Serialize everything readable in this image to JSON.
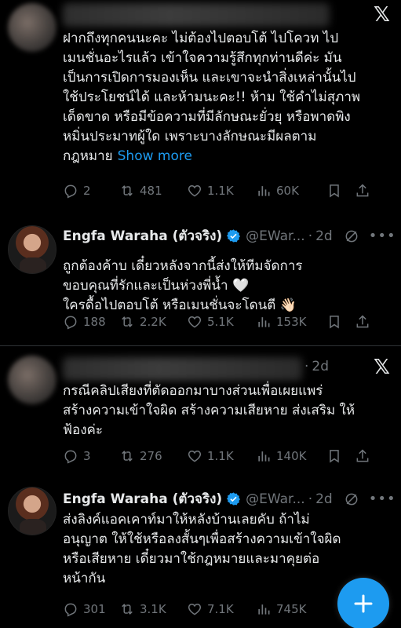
{
  "tweets": [
    {
      "header_time": "",
      "text_lines": [
        "ฝากถึงทุกคนนะคะ ไม่ต้องไปตอบโต้ ไปโควท ไป",
        "เมนชั่นอะไรแล้ว เข้าใจความรู้สึกทุกท่านดีค่ะ มัน",
        "เป็นการเปิดการมองเห็น และเขาจะนำสิ่งเหล่านั้นไป",
        "ใช้ประโยชน์ได้ และห้ามนะคะ!! ห้าม ใช้คำไม่สุภาพ",
        "เด็ดขาด หรือมีข้อความที่มีลักษณะยั่วยุ หรือพาดพิง",
        "หมิ่นประมาทผู้ใด เพราะบางลักษณะมีผลตาม",
        "กฎหมาย"
      ],
      "show_more": "Show more",
      "replies": "2",
      "reposts": "481",
      "likes": "1.1K",
      "views": "60K"
    },
    {
      "name": "Engfa Waraha (ตัวจริง)",
      "handle": "@EWar...",
      "time": "2d",
      "text_lines": [
        "ถูกต้องค้าบ เดี๋ยวหลังจากนี้ส่งให้ทีมจัดการ",
        "ขอบคุณที่รักและเป็นห่วงพี่น้ำ 🤍",
        "ใครดื้อไปตอบโต้ หรือเมนชั่นจะโดนตี 👋🏻"
      ],
      "replies": "188",
      "reposts": "2.2K",
      "likes": "5.1K",
      "views": "153K"
    },
    {
      "time": "2d",
      "text_lines": [
        "กรณีคลิปเสียงที่ตัดออกมาบางส่วนเพื่อเผยแพร่",
        "สร้างความเข้าใจผิด สร้างความเสียหาย ส่งเสริม ให้",
        "ฟ้องค่ะ"
      ],
      "replies": "3",
      "reposts": "276",
      "likes": "1.1K",
      "views": "140K"
    },
    {
      "name": "Engfa Waraha (ตัวจริง)",
      "handle": "@EWar...",
      "time": "2d",
      "text_lines": [
        "ส่งลิงค์แอคเคาท์มาให้หลังบ้านเลยคับ  ถ้าไม่",
        "อนุญาต ให้ใช้หรือลงสั้นๆเพื่อสร้างความเข้าใจผิด",
        "หรือเสียหาย เดี๋ยวมาใช้กฎหมายและมาคุยต่อ",
        "หน้ากัน"
      ],
      "replies": "301",
      "reposts": "3.1K",
      "likes": "7.1K",
      "views": "745K"
    }
  ],
  "colors": {
    "accent": "#1d9bf0",
    "muted": "#71767b",
    "text": "#e7e9ea",
    "bg": "#000000"
  },
  "icons": [
    "x-logo",
    "verified-badge-icon",
    "grok-icon",
    "more-icon",
    "reply-icon",
    "repost-icon",
    "like-icon",
    "views-icon",
    "bookmark-icon",
    "share-icon",
    "compose-plus-icon"
  ]
}
